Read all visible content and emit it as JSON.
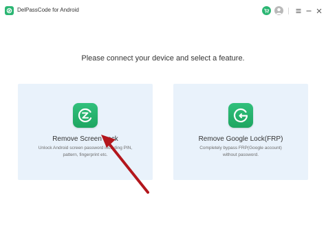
{
  "app": {
    "title": "DelPassCode for Android"
  },
  "main": {
    "prompt": "Please connect your device and select a feature."
  },
  "features": [
    {
      "title": "Remove Screen Lock",
      "desc_line1": "Unlock Android screen password including PIN,",
      "desc_line2": "pattern, fingerprint etc.",
      "icon": "screen-lock-z-icon"
    },
    {
      "title": "Remove Google Lock(FRP)",
      "desc_line1": "Completely bypass FRP(Google account)",
      "desc_line2": "without password.",
      "icon": "google-lock-g-icon"
    }
  ],
  "colors": {
    "brand_green": "#2bb673",
    "card_bg": "#e9f2fb",
    "annotation_arrow": "#b3161c"
  },
  "icons": {
    "titlebar": [
      "cart-icon",
      "user-icon",
      "menu-icon",
      "minimize-icon",
      "close-icon"
    ]
  }
}
